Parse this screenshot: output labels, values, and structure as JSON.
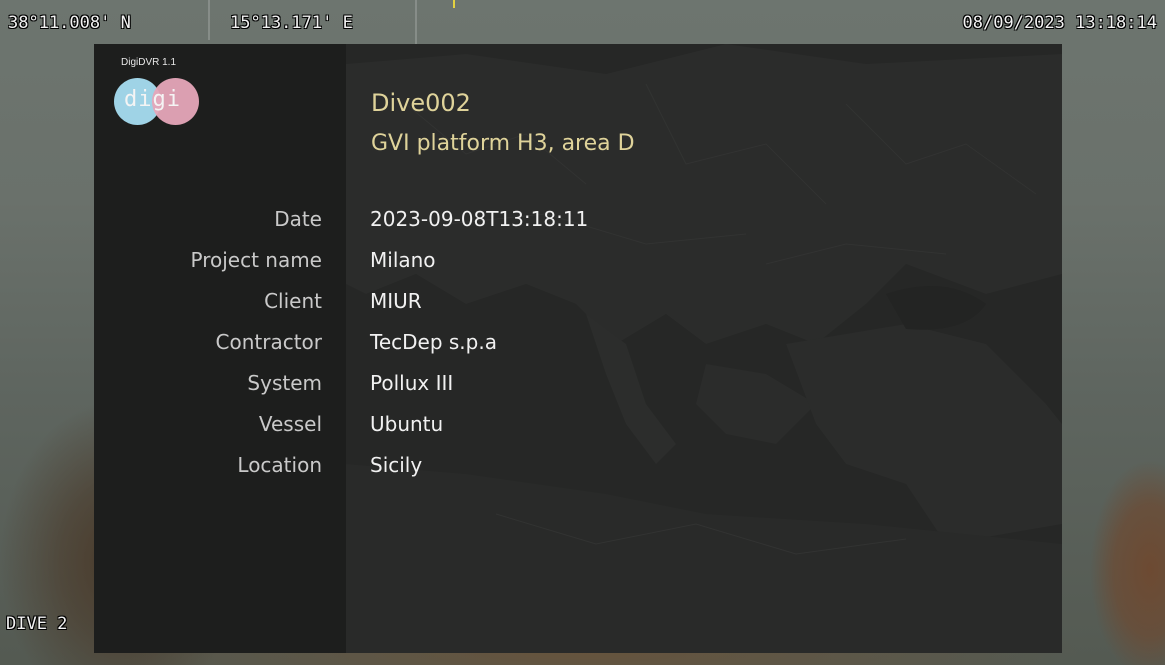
{
  "osd": {
    "latitude": "38°11.008' N",
    "longitude": "15°13.171' E",
    "datetime": "08/09/2023 13:18:14",
    "dive_label": "DIVE 2"
  },
  "brand": {
    "version": "DigiDVR 1.1",
    "logo_text": "digi",
    "logo_colors": [
      "#9fd3e6",
      "#e6a7b9"
    ]
  },
  "dive": {
    "name": "Dive002",
    "site": "GVI platform H3, area D"
  },
  "details": [
    {
      "label": "Date",
      "value": "2023-09-08T13:18:11"
    },
    {
      "label": "Project name",
      "value": "Milano"
    },
    {
      "label": "Client",
      "value": "MIUR"
    },
    {
      "label": "Contractor",
      "value": "TecDep s.p.a"
    },
    {
      "label": "System",
      "value": "Pollux III"
    },
    {
      "label": "Vessel",
      "value": "Ubuntu"
    },
    {
      "label": "Location",
      "value": "Sicily"
    }
  ],
  "colors": {
    "title_accent": "#dfd39a",
    "panel_dark": "#1d1e1d",
    "panel": "#272827"
  }
}
